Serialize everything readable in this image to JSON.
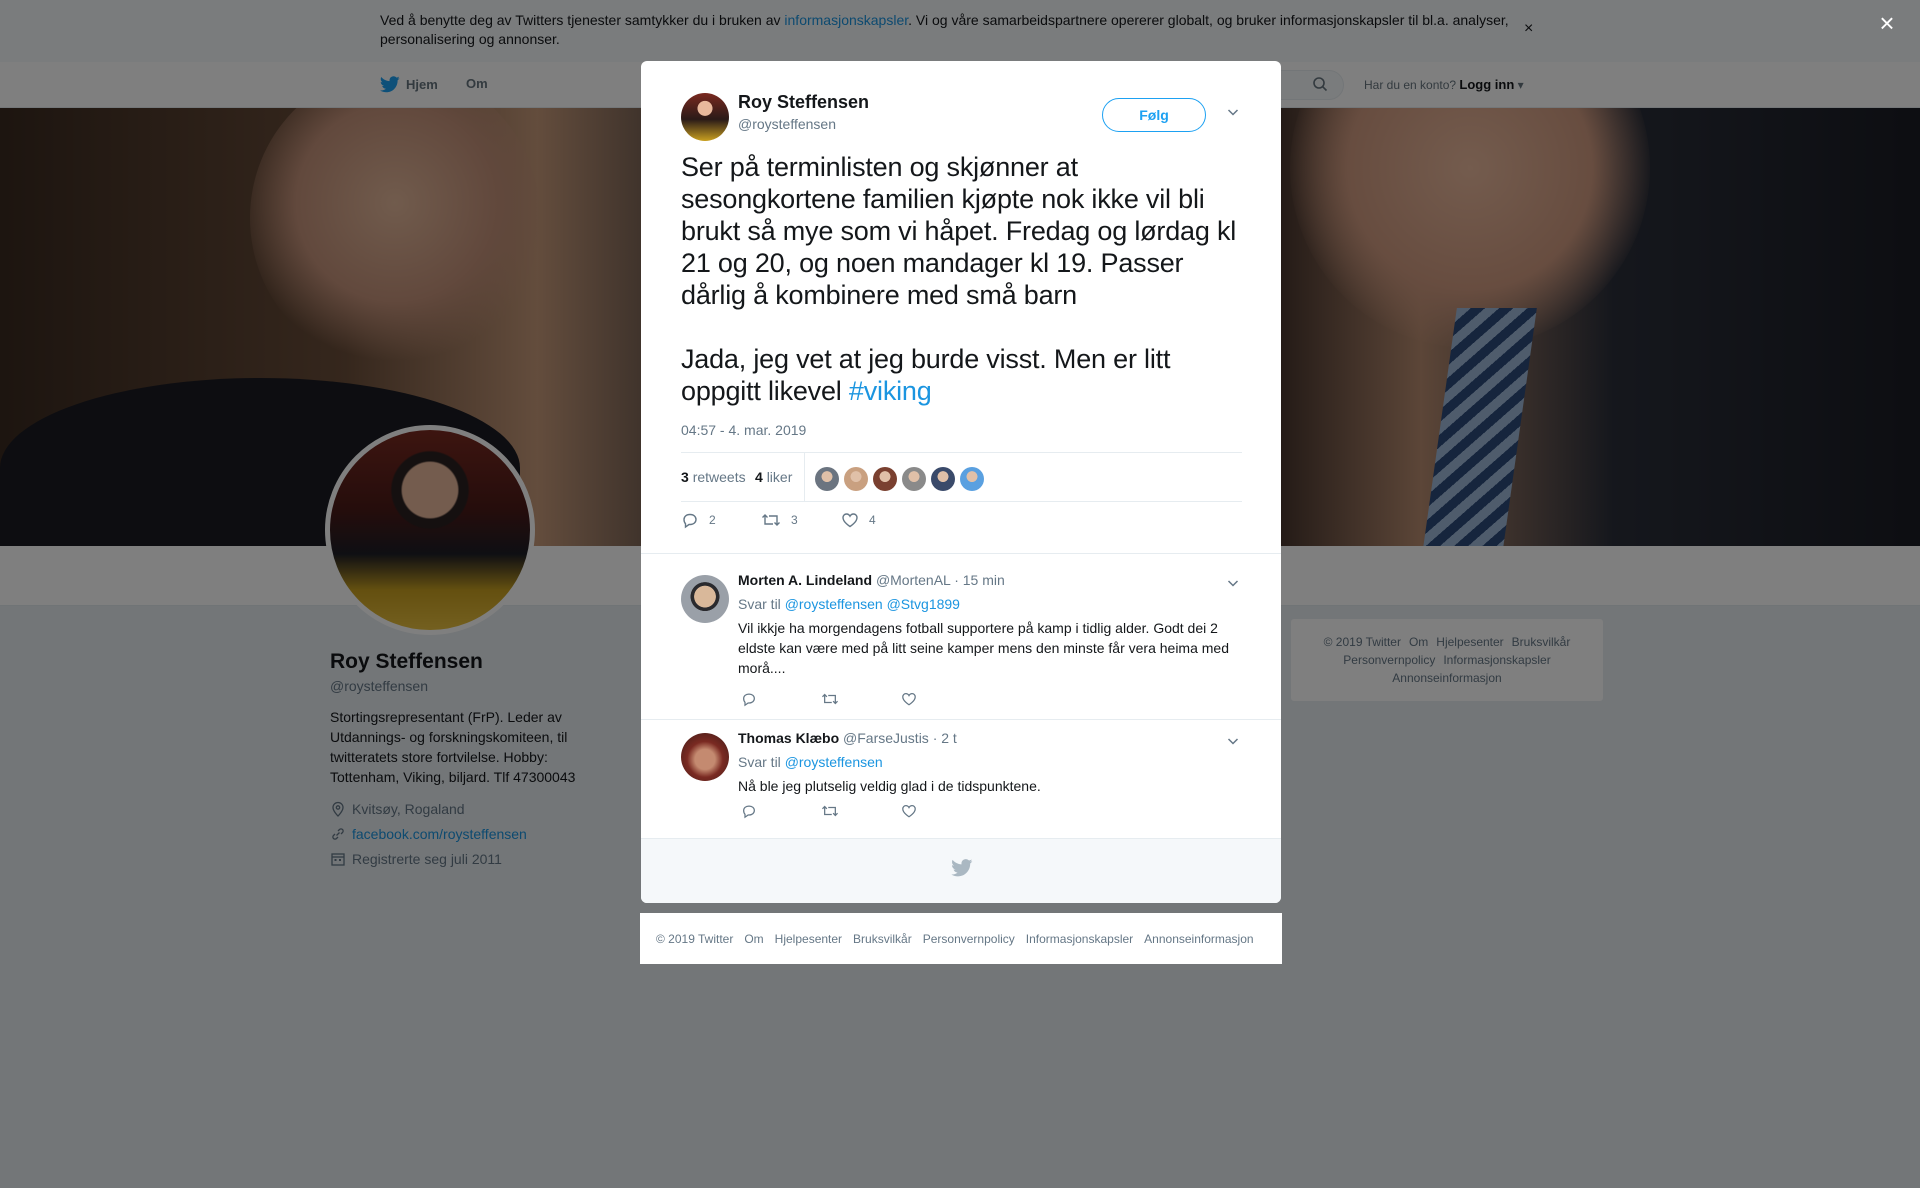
{
  "cookie_bar": {
    "text_before": "Ved å benytte deg av Twitters tjenester samtykker du i bruken av ",
    "link": "informasjonskapsler",
    "text_after": ". Vi og våre samarbeidspartnere opererer globalt, og bruker informasjonskapsler til bl.a. analyser, personalisering og annonser.",
    "close": "×"
  },
  "nav": {
    "home": "Hjem",
    "about": "Om",
    "have_account": "Har du en konto?",
    "login": "Logg inn"
  },
  "profile": {
    "name": "Roy Steffensen",
    "handle": "@roysteffensen",
    "bio": "Stortingsrepresentant (FrP). Leder av Utdannings- og forskningskomiteen, til twitteratets store fortvilelse. Hobby: Tottenham, Viking, biljard. Tlf 47300043",
    "location": "Kvitsøy, Rogaland",
    "website": "facebook.com/roysteffensen",
    "joined": "Registrerte seg juli 2011"
  },
  "side_footer": {
    "line1": [
      "© 2019 Twitter",
      "Om",
      "Hjelpesenter",
      "Bruksvilkår"
    ],
    "line2": [
      "Personvernpolicy",
      "Informasjonskapsler"
    ],
    "line3": [
      "Annonseinformasjon"
    ]
  },
  "modal": {
    "close": "×",
    "author_name": "Roy Steffensen",
    "author_handle": "@roysteffensen",
    "follow": "Følg",
    "tweet_text": "Ser på terminlisten og skjønner at sesongkortene familien kjøpte nok ikke vil bli brukt så mye som vi håpet. Fredag og lørdag kl 21 og 20, og noen mandager kl 19. Passer dårlig å kombinere med små barn\n\nJada, jeg vet at jeg burde visst. Men er litt oppgitt likevel ",
    "hashtag": "#viking",
    "time": "04:57 - 4. mar. 2019",
    "retweets_count": "3",
    "retweets_label": "retweets",
    "likes_count": "4",
    "likes_label": "liker",
    "reply_count": "2",
    "retweet_count": "3",
    "like_count": "4",
    "liker_colors": [
      "#6b7480",
      "#c9a080",
      "#7a4030",
      "#8a8a8a",
      "#3a4a6a",
      "#5aa0e0"
    ]
  },
  "replies": [
    {
      "name": "Morten A. Lindeland",
      "handle": "@MortenAL",
      "time": "· 15 min",
      "reply_to_label": "Svar til",
      "mentions": [
        "@roysteffensen",
        "@Stvg1899"
      ],
      "text": "Vil ikkje ha morgendagens fotball supportere på kamp i tidlig alder. Godt dei 2 eldste kan være med på litt seine kamper mens den minste får vera heima med morå....",
      "avatar_color": "#9aa0a8"
    },
    {
      "name": "Thomas Klæbo",
      "handle": "@FarseJustis",
      "time": "· 2 t",
      "reply_to_label": "Svar til",
      "mentions": [
        "@roysteffensen"
      ],
      "text": "Nå ble jeg plutselig veldig glad i de tidspunktene.",
      "avatar_color": "#7a2a22"
    }
  ],
  "footer": {
    "items": [
      "© 2019 Twitter",
      "Om",
      "Hjelpesenter",
      "Bruksvilkår",
      "Personvernpolicy",
      "Informasjonskapsler",
      "Annonseinformasjon"
    ]
  },
  "colors": {
    "accent": "#1da1f2",
    "link": "#1b95e0",
    "muted": "#657786"
  }
}
